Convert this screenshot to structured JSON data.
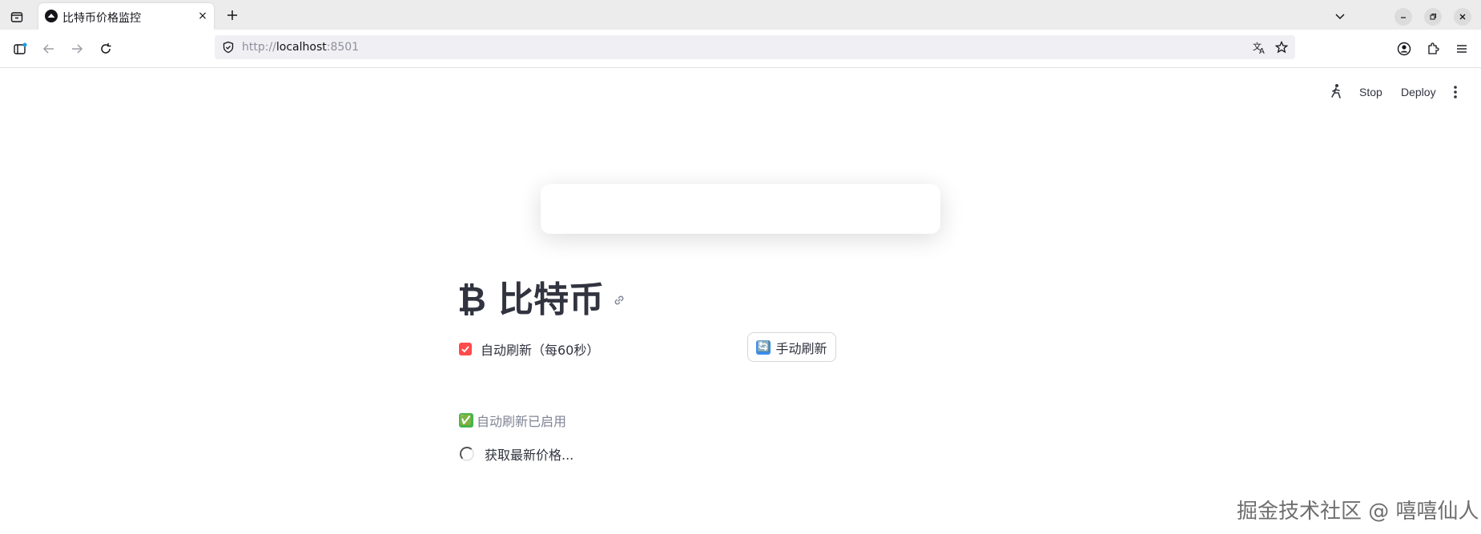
{
  "browser": {
    "tab_title": "比特币价格监控",
    "tab_close": "×",
    "new_tab": "+",
    "url_scheme": "http://",
    "url_host": "localhost",
    "url_port": ":8501"
  },
  "app_header": {
    "stop_label": "Stop",
    "deploy_label": "Deploy"
  },
  "main": {
    "title": "₿ 比特币",
    "auto_refresh_label": "自动刷新（每60秒）",
    "auto_refresh_checked": true,
    "manual_refresh_emoji": "🔄",
    "manual_refresh_label": "手动刷新",
    "status_emoji": "✅",
    "status_text": "自动刷新已启用",
    "loading_text": "获取最新价格..."
  },
  "watermark": "掘金技术社区 @ 嘻嘻仙人",
  "colors": {
    "accent": "#ff4b4b",
    "text": "#31333f",
    "muted": "#808495"
  }
}
